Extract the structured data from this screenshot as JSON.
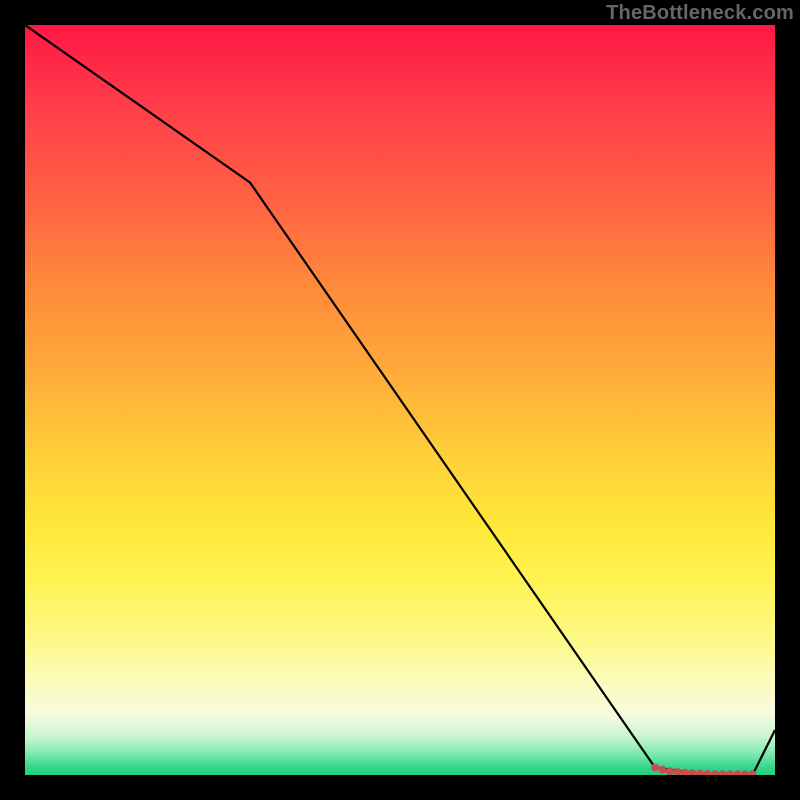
{
  "watermark": "TheBottleneck.com",
  "chart_data": {
    "type": "line",
    "title": "",
    "xlabel": "",
    "ylabel": "",
    "xlim": [
      0,
      100
    ],
    "ylim": [
      0,
      100
    ],
    "grid": false,
    "legend": false,
    "series": [
      {
        "name": "curve",
        "x": [
          0,
          30,
          84,
          91,
          97,
          100
        ],
        "y": [
          100,
          79,
          1,
          0,
          0,
          6
        ]
      }
    ],
    "markers": {
      "name": "highlight-cluster",
      "color": "#c94f4f",
      "points": [
        {
          "x": 84.0,
          "y": 1.0
        },
        {
          "x": 85.0,
          "y": 0.7
        },
        {
          "x": 86.0,
          "y": 0.5
        },
        {
          "x": 87.0,
          "y": 0.4
        },
        {
          "x": 88.0,
          "y": 0.3
        },
        {
          "x": 89.0,
          "y": 0.25
        },
        {
          "x": 90.0,
          "y": 0.2
        },
        {
          "x": 91.0,
          "y": 0.15
        },
        {
          "x": 92.0,
          "y": 0.12
        },
        {
          "x": 93.0,
          "y": 0.1
        },
        {
          "x": 94.0,
          "y": 0.1
        },
        {
          "x": 95.0,
          "y": 0.1
        },
        {
          "x": 96.0,
          "y": 0.1
        },
        {
          "x": 97.0,
          "y": 0.1
        }
      ]
    }
  }
}
